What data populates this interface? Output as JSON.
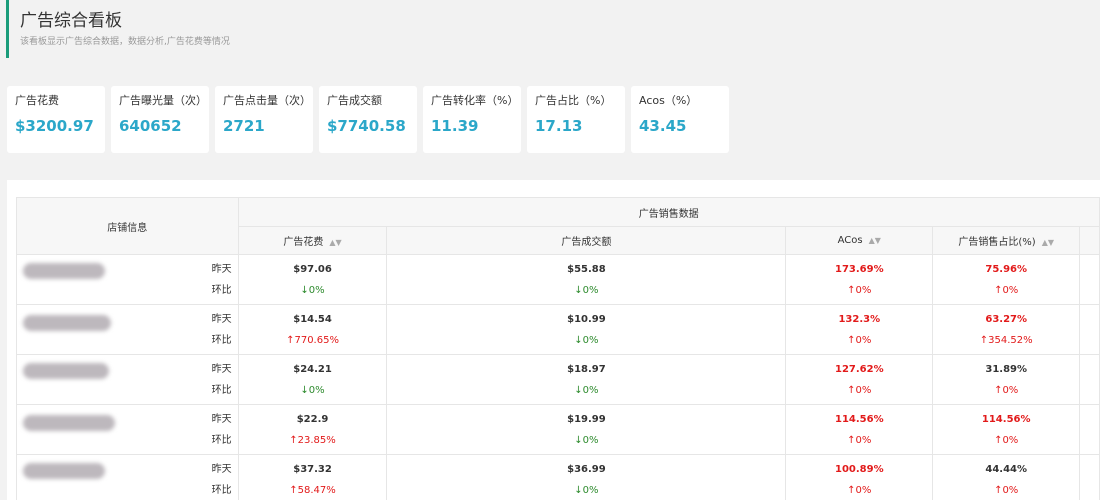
{
  "header": {
    "title": "广告综合看板",
    "subtitle": "该看板显示广告综合数据，数据分析,广告花费等情况"
  },
  "cards": [
    {
      "label": "广告花费",
      "value": "$3200.97"
    },
    {
      "label": "广告曝光量（次）",
      "value": "640652"
    },
    {
      "label": "广告点击量（次）",
      "value": "2721"
    },
    {
      "label": "广告成交额",
      "value": "$7740.58"
    },
    {
      "label": "广告转化率（%）",
      "value": "11.39"
    },
    {
      "label": "广告占比（%）",
      "value": "17.13"
    },
    {
      "label": "Acos（%）",
      "value": "43.45"
    }
  ],
  "table": {
    "store_header": "店铺信息",
    "group_header": "广告销售数据",
    "columns": [
      "广告花费",
      "广告成交额",
      "ACos",
      "广告销售占比(%)"
    ],
    "row_label_1": "昨天",
    "row_label_2": "环比",
    "rows": [
      {
        "spend": "$97.06",
        "spend_chg": "↓0%",
        "sales": "$55.88",
        "sales_chg": "↓0%",
        "acos": "173.69%",
        "acos_chg": "↑0%",
        "share": "75.96%",
        "share_chg": "↑0%"
      },
      {
        "spend": "$14.54",
        "spend_chg": "↑770.65%",
        "sales": "$10.99",
        "sales_chg": "↓0%",
        "acos": "132.3%",
        "acos_chg": "↑0%",
        "share": "63.27%",
        "share_chg": "↑354.52%"
      },
      {
        "spend": "$24.21",
        "spend_chg": "↓0%",
        "sales": "$18.97",
        "sales_chg": "↓0%",
        "acos": "127.62%",
        "acos_chg": "↑0%",
        "share": "31.89%",
        "share_chg": "↑0%"
      },
      {
        "spend": "$22.9",
        "spend_chg": "↑23.85%",
        "sales": "$19.99",
        "sales_chg": "↓0%",
        "acos": "114.56%",
        "acos_chg": "↑0%",
        "share": "114.56%",
        "share_chg": "↑0%"
      },
      {
        "spend": "$37.32",
        "spend_chg": "↑58.47%",
        "sales": "$36.99",
        "sales_chg": "↓0%",
        "acos": "100.89%",
        "acos_chg": "↑0%",
        "share": "44.44%",
        "share_chg": "↑0%"
      }
    ]
  },
  "colors": {
    "accent_bar": "#1a9c7a",
    "card_value": "#2ba7c9",
    "up_red": "#e21a1a",
    "down_green": "#2e8b2e"
  },
  "icons": {
    "sort": "sort-icon"
  }
}
